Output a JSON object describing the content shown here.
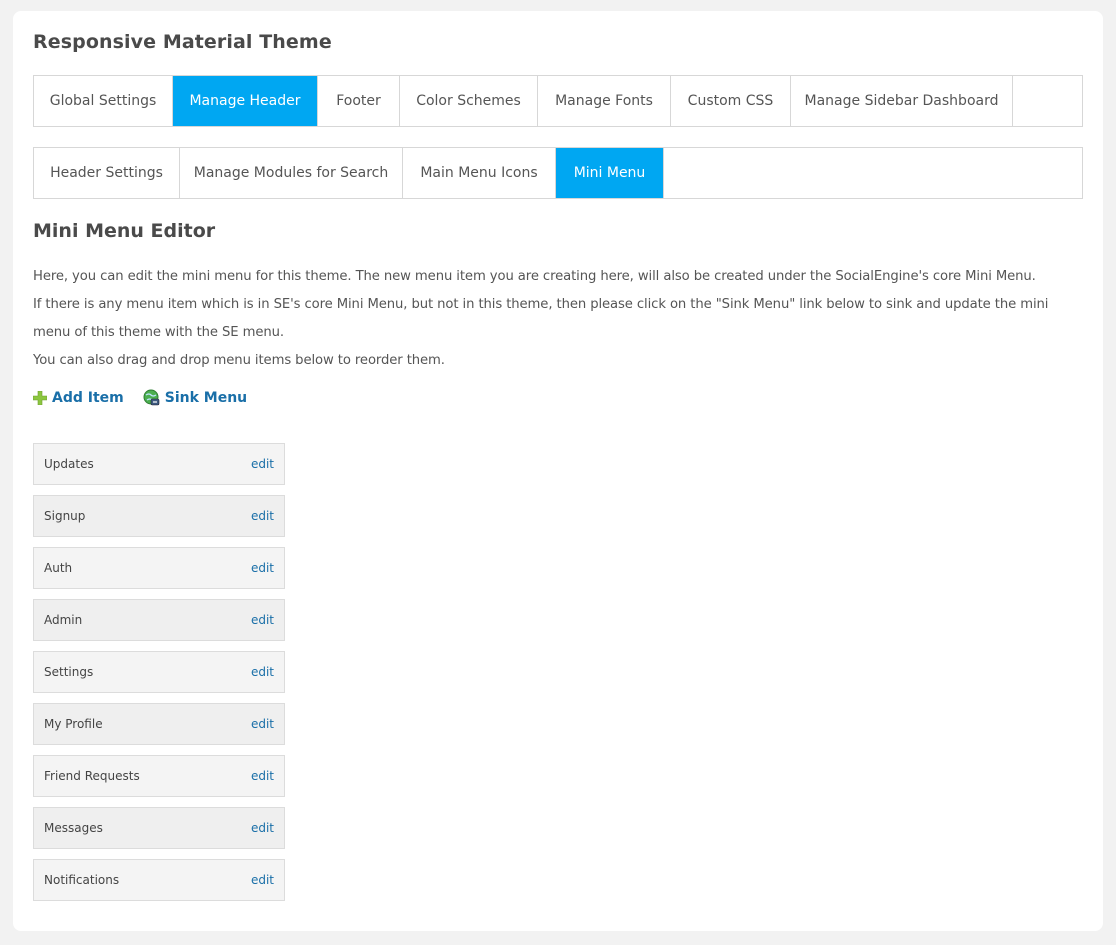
{
  "page": {
    "title": "Responsive Material Theme"
  },
  "main_tabs": [
    {
      "label": "Global Settings",
      "active": false
    },
    {
      "label": "Manage Header",
      "active": true
    },
    {
      "label": "Footer",
      "active": false
    },
    {
      "label": "Color Schemes",
      "active": false
    },
    {
      "label": "Manage Fonts",
      "active": false
    },
    {
      "label": "Custom CSS",
      "active": false
    },
    {
      "label": "Manage Sidebar Dashboard",
      "active": false
    }
  ],
  "sub_tabs": [
    {
      "label": "Header Settings",
      "active": false
    },
    {
      "label": "Manage Modules for Search",
      "active": false
    },
    {
      "label": "Main Menu Icons",
      "active": false
    },
    {
      "label": "Mini Menu",
      "active": true
    }
  ],
  "editor": {
    "title": "Mini Menu Editor",
    "description": [
      "Here, you can edit the mini menu for this theme. The new menu item you are creating here, will also be created under the SocialEngine's core Mini Menu.",
      "If there is any menu item which is in SE's core Mini Menu, but not in this theme, then please click on the \"Sink Menu\" link below to sink and update the mini menu of this theme with the SE menu.",
      "You can also drag and drop menu items below to reorder them."
    ],
    "actions": {
      "add_item": {
        "label": "Add Item",
        "icon": "plus-icon"
      },
      "sink_menu": {
        "label": "Sink Menu",
        "icon": "sync-globe-icon"
      }
    },
    "items": [
      {
        "label": "Updates",
        "edit_label": "edit"
      },
      {
        "label": "Signup",
        "edit_label": "edit"
      },
      {
        "label": "Auth",
        "edit_label": "edit"
      },
      {
        "label": "Admin",
        "edit_label": "edit"
      },
      {
        "label": "Settings",
        "edit_label": "edit"
      },
      {
        "label": "My Profile",
        "edit_label": "edit"
      },
      {
        "label": "Friend Requests",
        "edit_label": "edit"
      },
      {
        "label": "Messages",
        "edit_label": "edit"
      },
      {
        "label": "Notifications",
        "edit_label": "edit"
      }
    ]
  },
  "colors": {
    "accent": "#00a7f2",
    "link": "#1a6fa8",
    "add_icon": "#8cc63f"
  }
}
